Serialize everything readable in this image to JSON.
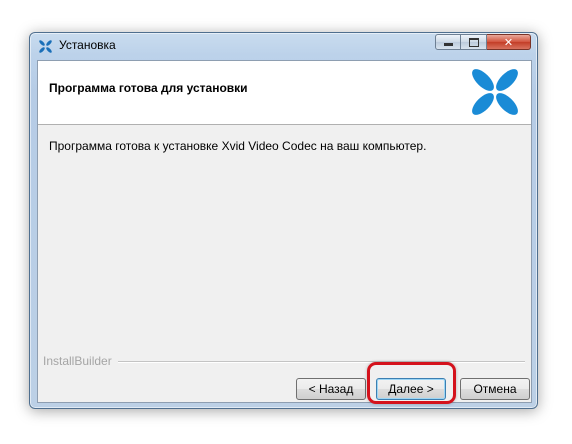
{
  "window": {
    "title": "Установка",
    "buttons": {
      "minimize": "minimize",
      "maximize": "maximize",
      "close": "✕"
    }
  },
  "header": {
    "title": "Программа готова для установки",
    "logo_icon": "xvid-logo",
    "logo_color": "#1a8bd6"
  },
  "content": {
    "message": "Программа готова к установке Xvid Video Codec на ваш компьютер."
  },
  "footer": {
    "brand": "InstallBuilder",
    "buttons": {
      "back": "< Назад",
      "next": "Далее >",
      "cancel": "Отмена"
    }
  },
  "annotation": {
    "highlight_color": "#d4121c"
  }
}
